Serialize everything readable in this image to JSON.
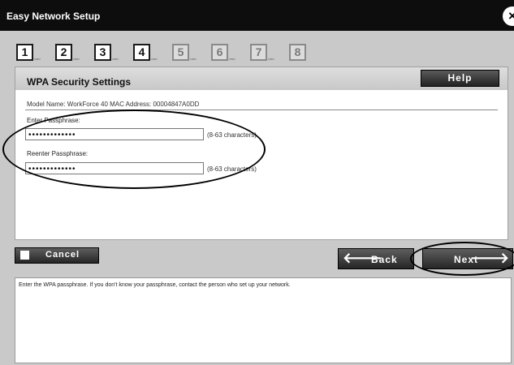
{
  "window": {
    "title": "Easy Network Setup"
  },
  "steps": [
    {
      "number": "1",
      "dots": "▫▫▫",
      "active": true
    },
    {
      "number": "2",
      "dots": "▫▫▫",
      "active": true
    },
    {
      "number": "3",
      "dots": "▫▫▫",
      "active": true
    },
    {
      "number": "4",
      "dots": "▫▫▫",
      "active": true
    },
    {
      "number": "5",
      "dots": "▫▫▫",
      "active": false
    },
    {
      "number": "6",
      "dots": "▫▫▫",
      "active": false
    },
    {
      "number": "7",
      "dots": "▫▫▫",
      "active": false
    },
    {
      "number": "8",
      "dots": "",
      "active": false
    }
  ],
  "panel": {
    "title": "WPA Security Settings",
    "help_label": "Help",
    "model_info": "Model Name: WorkForce 40   MAC Address: 00004847A0DD"
  },
  "fields": {
    "passphrase": {
      "label": "Enter Passphrase:",
      "value": "•••••••••••••",
      "hint": "(8-63 characters)"
    },
    "reenter": {
      "label": "Reenter Passphrase:",
      "value": "•••••••••••••",
      "hint": "(8-63 characters)"
    }
  },
  "buttons": {
    "cancel_label": "Cancel",
    "back_label": "Back",
    "next_label": "Next",
    "back_arrow": "🡐",
    "next_arrow": "🡒"
  },
  "message": "Enter the WPA passphrase. If you don't know your passphrase, contact the person who set up your network.",
  "icons": {
    "close": "close-icon",
    "back": "arrow-left-icon",
    "next": "arrow-right-icon"
  }
}
